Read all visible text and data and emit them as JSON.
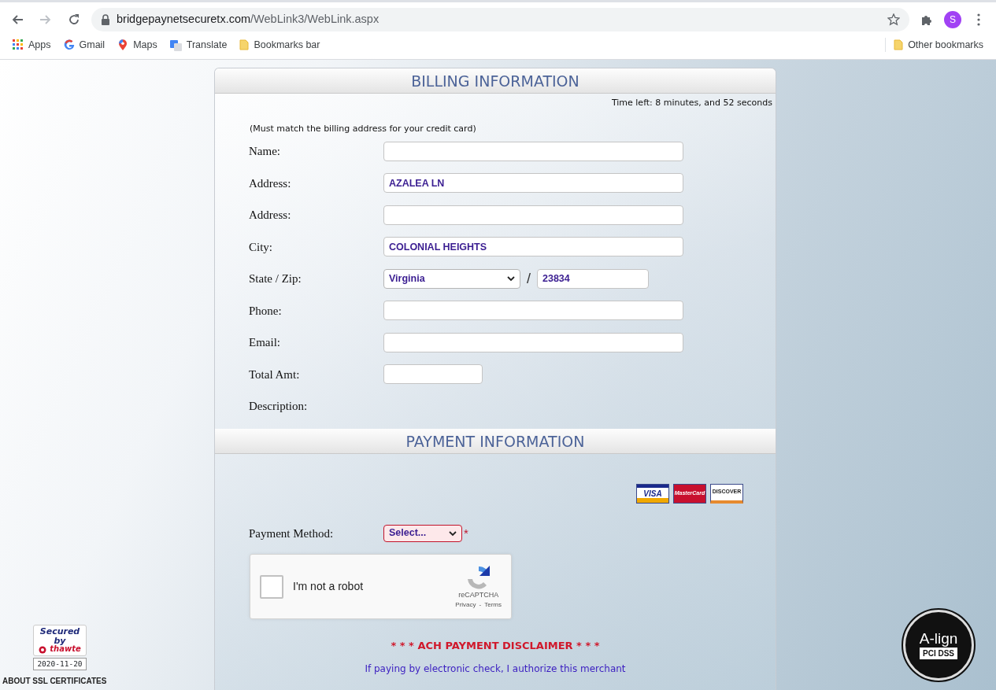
{
  "browser": {
    "forward_disabled": true,
    "url_host": "bridgepaynetsecuretx.com",
    "url_path": "/WebLink3/WebLink.aspx",
    "profile_initial": "S",
    "bookmarks": [
      {
        "kind": "apps",
        "label": "Apps"
      },
      {
        "kind": "google",
        "label": "Gmail"
      },
      {
        "kind": "maps",
        "label": "Maps"
      },
      {
        "kind": "translate",
        "label": "Translate"
      },
      {
        "kind": "folder",
        "label": "Bookmarks bar"
      }
    ],
    "other_bookmarks": "Other bookmarks"
  },
  "billing": {
    "title": "BILLING INFORMATION",
    "time_left": "Time left: 8 minutes, and 52 seconds",
    "note": "(Must match the billing address for your credit card)",
    "fields": [
      {
        "kind": "text",
        "label": "Name:"
      },
      {
        "kind": "text",
        "label": "Address:",
        "value": "AZALEA LN"
      },
      {
        "kind": "text",
        "label": "Address:"
      },
      {
        "kind": "text",
        "label": "City:",
        "value": "COLONIAL HEIGHTS"
      },
      {
        "kind": "state_zip",
        "label": "State / Zip:",
        "value": "Virginia",
        "separator": "/",
        "zip": "23834"
      },
      {
        "kind": "text",
        "label": "Phone:"
      },
      {
        "kind": "text",
        "label": "Email:"
      },
      {
        "kind": "short",
        "label": "Total Amt:"
      },
      {
        "kind": "none",
        "label": "Description:"
      }
    ]
  },
  "payment": {
    "title": "PAYMENT INFORMATION",
    "card_logos": [
      {
        "kind": "visa",
        "label": "VISA"
      },
      {
        "kind": "mastercard",
        "label": "MasterCard"
      },
      {
        "kind": "discover",
        "label": "DISCOVER"
      }
    ],
    "method": {
      "label": "Payment Method:",
      "value": "Select...",
      "required": "*"
    },
    "captcha": {
      "checked": false,
      "label": "I'm not a robot",
      "brand": "reCAPTCHA",
      "links": [
        "Privacy",
        "Terms"
      ],
      "link_separator": "-"
    },
    "disclaimer_title": "* * * ACH PAYMENT DISCLAIMER * * *",
    "disclaimer_text": "If paying by electronic check, I authorize this merchant"
  },
  "badges": {
    "thawte": {
      "line1": "Secured",
      "line2": "by",
      "brand": "thawte",
      "date": "2020-11-20"
    },
    "ssl_link": "ABOUT SSL CERTIFICATES",
    "pci": {
      "brand": "A-lign",
      "label": "PCI DSS"
    }
  }
}
